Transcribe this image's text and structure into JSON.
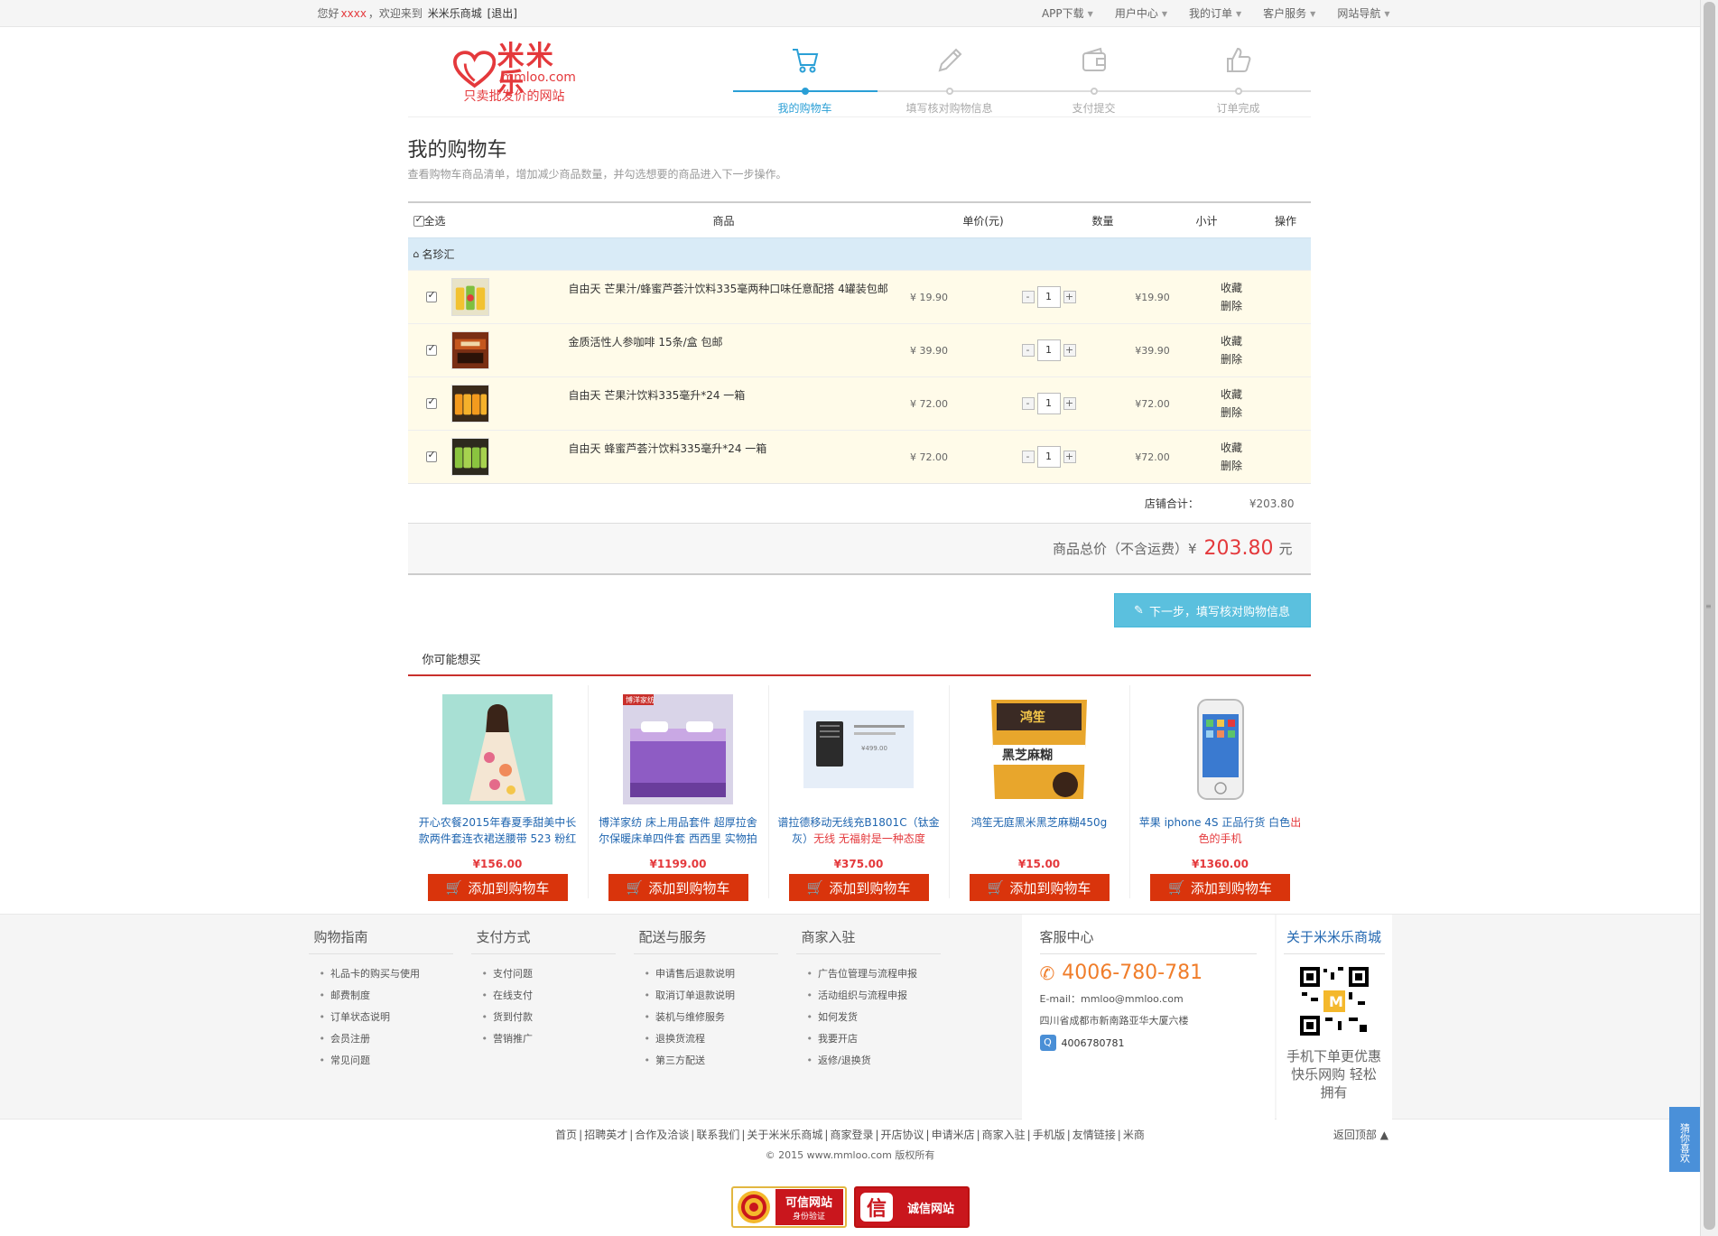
{
  "topbar": {
    "greeting": "您好",
    "username": "xxxx",
    "welcome": "，欢迎来到",
    "site_name": "米米乐商城",
    "logout": "[退出]",
    "menus": [
      "APP下载",
      "用户中心",
      "我的订单",
      "客户服务",
      "网站导航"
    ]
  },
  "logo": {
    "name": "米米乐",
    "domain": "mmloo.com",
    "slogan": "只卖批发价的网站"
  },
  "steps": [
    {
      "label": "我的购物车",
      "icon": "cart-icon",
      "active": true
    },
    {
      "label": "填写核对购物信息",
      "icon": "pencil-icon",
      "active": false
    },
    {
      "label": "支付提交",
      "icon": "wallet-icon",
      "active": false
    },
    {
      "label": "订单完成",
      "icon": "thumbs-up-icon",
      "active": false
    }
  ],
  "page": {
    "title": "我的购物车",
    "subtitle": "查看购物车商品清单，增加减少商品数量，并勾选想要的商品进入下一步操作。"
  },
  "cart": {
    "headers": {
      "select_all": "全选",
      "product": "商品",
      "price": "单价(元)",
      "qty": "数量",
      "subtotal": "小计",
      "ops": "操作"
    },
    "shop_name": "名珍汇",
    "items": [
      {
        "name": "自由天 芒果汁/蜂蜜芦荟汁饮料335毫两种口味任意配搭 4罐装包邮",
        "price": "¥ 19.90",
        "qty": "1",
        "subtotal": "¥19.90",
        "fav": "收藏",
        "del": "删除"
      },
      {
        "name": "金质活性人参咖啡 15条/盒 包邮",
        "price": "¥ 39.90",
        "qty": "1",
        "subtotal": "¥39.90",
        "fav": "收藏",
        "del": "删除"
      },
      {
        "name": "自由天 芒果汁饮料335毫升*24 一箱",
        "price": "¥ 72.00",
        "qty": "1",
        "subtotal": "¥72.00",
        "fav": "收藏",
        "del": "删除"
      },
      {
        "name": "自由天 蜂蜜芦荟汁饮料335毫升*24 一箱",
        "price": "¥ 72.00",
        "qty": "1",
        "subtotal": "¥72.00",
        "fav": "收藏",
        "del": "删除"
      }
    ],
    "shop_total_label": "店铺合计：",
    "shop_total_value": "¥203.80",
    "grand_label": "商品总价（不含运费）¥",
    "grand_value": "203.80",
    "grand_unit": "元",
    "next_button": "下一步，填写核对购物信息"
  },
  "recommend": {
    "title": "你可能想买",
    "add_label": "添加到购物车",
    "items": [
      {
        "title": "开心农餐2015年春夏季甜美中长款两件套连衣裙送腰带 523 粉红",
        "highlight": "",
        "price": "¥156.00"
      },
      {
        "title": "博洋家纺 床上用品套件 超厚拉舍尔保暖床单四件套 西西里 实物拍",
        "highlight": "",
        "price": "¥1199.00"
      },
      {
        "title": "谱拉德移动无线充B1801C（钛金灰）",
        "highlight": "无线 无福射是一种态度",
        "price": "¥375.00"
      },
      {
        "title": "鸿笙无庭黑米黑芝麻糊450g",
        "highlight": "",
        "price": "¥15.00"
      },
      {
        "title": "苹果 iphone 4S 正品行货 白色",
        "highlight": "出色的手机",
        "price": "¥1360.00"
      }
    ],
    "item1_tag": "博洋家纺",
    "item2_caption": "¥499.00",
    "item3_label": "黑芝麻糊",
    "item3_brand": "鸿笙"
  },
  "footer": {
    "columns": [
      {
        "title": "购物指南",
        "links": [
          "礼品卡的购买与使用",
          "邮费制度",
          "订单状态说明",
          "会员注册",
          "常见问题"
        ]
      },
      {
        "title": "支付方式",
        "links": [
          "支付问题",
          "在线支付",
          "货到付款",
          "营销推广"
        ]
      },
      {
        "title": "配送与服务",
        "links": [
          "申请售后退款说明",
          "取消订单退款说明",
          "装机与维修服务",
          "退换货流程",
          "第三方配送"
        ]
      },
      {
        "title": "商家入驻",
        "links": [
          "广告位管理与流程申报",
          "活动组织与流程申报",
          "如何发货",
          "我要开店",
          "返修/退换货"
        ]
      }
    ],
    "service": {
      "title": "客服中心",
      "phone": "4006-780-781",
      "email": "E-mail：mmloo@mmloo.com",
      "address": "四川省成都市新南路亚华大厦六楼",
      "qq": "4006780781"
    },
    "about": {
      "title": "关于米米乐商城",
      "text": "手机下单更优惠 快乐网购 轻松拥有"
    },
    "links": [
      "首页",
      "招聘英才",
      "合作及洽谈",
      "联系我们",
      "关于米米乐商城",
      "商家登录",
      "开店协议",
      "申请米店",
      "商家入驻",
      "手机版",
      "友情链接",
      "米商"
    ],
    "copyright": "© 2015 www.mmloo.com 版权所有",
    "back_top": "返回顶部",
    "badge1_title": "可信网站",
    "badge1_sub": "身份验证",
    "badge2_title": "诚信网站",
    "badge2_mark": "信"
  },
  "side_tab": "猜你喜欢",
  "colors": {
    "brand_red": "#e4393c",
    "step_blue": "#2a9fd6",
    "next_button": "#5bc0de",
    "add_button": "#d9340c",
    "shop_row": "#d9ebf7",
    "item_row": "#fffbe9"
  }
}
